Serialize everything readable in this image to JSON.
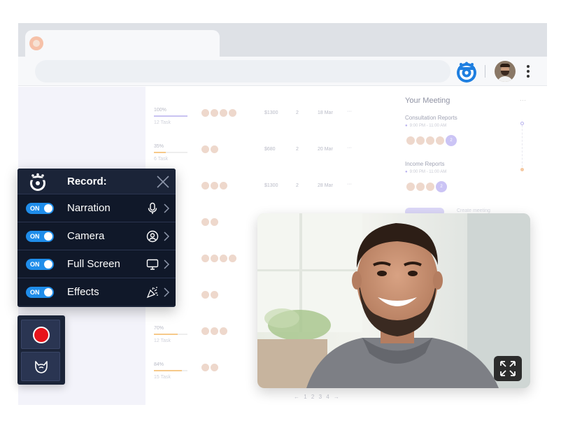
{
  "browser": {
    "extension_icon": "recorder-logo-icon",
    "menu_icon": "more-vertical-icon"
  },
  "table": {
    "rows": [
      {
        "progress": "100%",
        "progress_value": 1.0,
        "tasks": "12 Task",
        "price": "$1300",
        "files": "2",
        "date": "18 Mar",
        "avatars": 4
      },
      {
        "progress": "35%",
        "progress_value": 0.35,
        "tasks": "6 Task",
        "price": "$680",
        "files": "2",
        "date": "20 Mar",
        "avatars": 2
      },
      {
        "progress": "",
        "progress_value": 0,
        "tasks": "",
        "price": "$1300",
        "files": "2",
        "date": "28 Mar",
        "avatars": 3
      },
      {
        "progress": "",
        "progress_value": 0,
        "tasks": "",
        "price": "",
        "files": "",
        "date": "",
        "avatars": 2
      },
      {
        "progress": "",
        "progress_value": 0,
        "tasks": "",
        "price": "",
        "files": "",
        "date": "",
        "avatars": 4
      },
      {
        "progress": "",
        "progress_value": 0,
        "tasks": "",
        "price": "",
        "files": "",
        "date": "",
        "avatars": 2
      },
      {
        "progress": "70%",
        "progress_value": 0.7,
        "tasks": "12 Task",
        "price": "",
        "files": "",
        "date": "",
        "avatars": 3
      },
      {
        "progress": "84%",
        "progress_value": 0.84,
        "tasks": "15 Task",
        "price": "",
        "files": "",
        "date": "",
        "avatars": 2
      }
    ],
    "more_label": "···",
    "pager": "← 1 2 3 4 →"
  },
  "meeting": {
    "title": "Your Meeting",
    "more_label": "···",
    "items": [
      {
        "name": "Consultation Reports",
        "time": "9:00 PM - 11:00 AM",
        "extra": "2"
      },
      {
        "name": "Income Reports",
        "time": "9:00 PM - 11:00 AM",
        "extra": "2"
      }
    ],
    "create_label": "Create meeting"
  },
  "record_panel": {
    "title": "Record:",
    "rows": [
      {
        "toggle": "ON",
        "label": "Narration",
        "icon": "microphone-icon"
      },
      {
        "toggle": "ON",
        "label": "Camera",
        "icon": "user-circle-icon"
      },
      {
        "toggle": "ON",
        "label": "Full Screen",
        "icon": "monitor-icon"
      },
      {
        "toggle": "ON",
        "label": "Effects",
        "icon": "party-popper-icon"
      }
    ]
  },
  "dock": {
    "record_icon": "record-icon",
    "effects_icon": "beard-icon"
  },
  "webcam": {
    "expand_icon": "expand-icon"
  },
  "colors": {
    "panel_bg": "#1b2438",
    "toggle_on": "#1f8dea",
    "record_red": "#e8141b",
    "accent_purple": "#cbc4f5"
  }
}
